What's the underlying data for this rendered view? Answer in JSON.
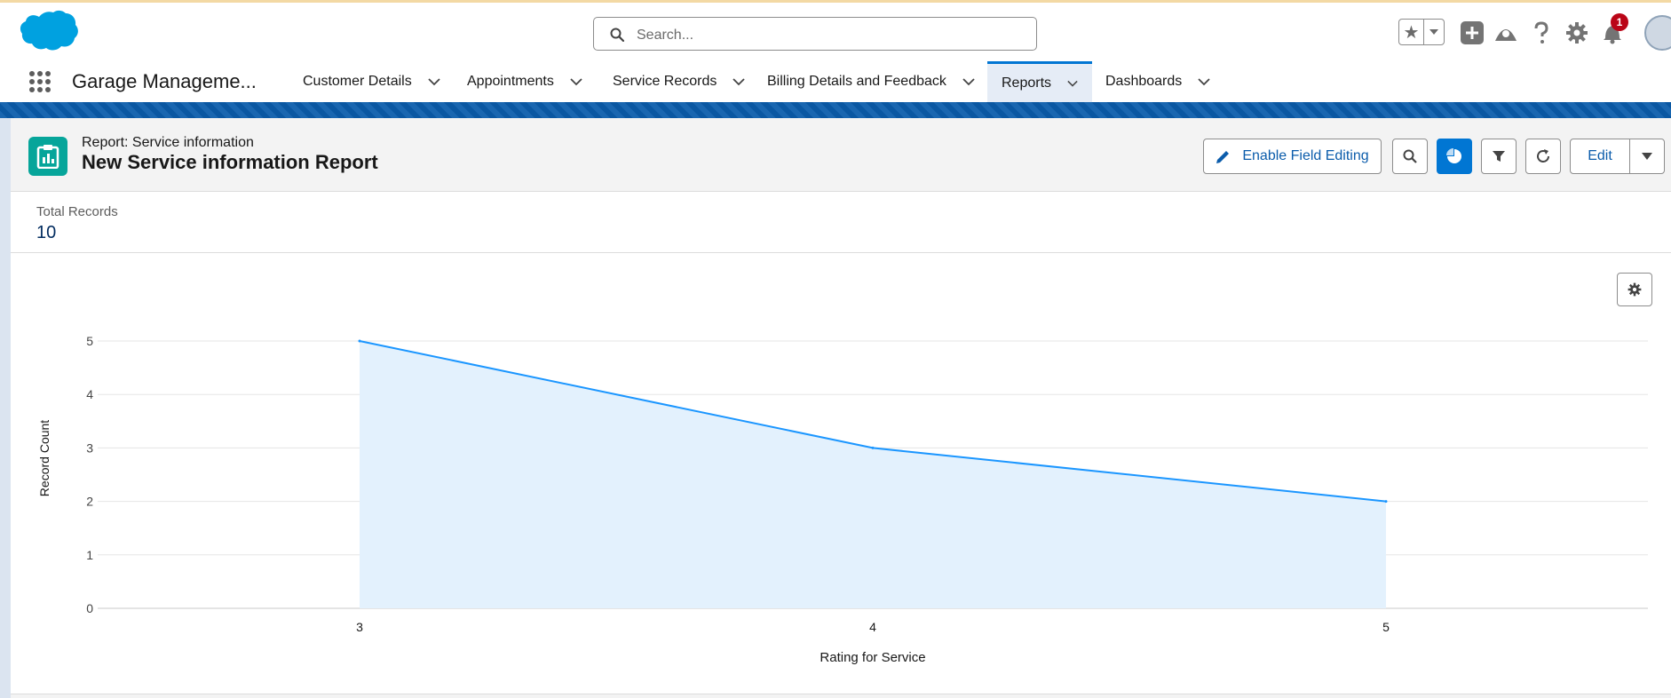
{
  "search": {
    "placeholder": "Search..."
  },
  "notifications": {
    "count": "1"
  },
  "app": {
    "name": "Garage Manageme..."
  },
  "nav": {
    "tabs": [
      {
        "label": "Customer Details"
      },
      {
        "label": "Appointments"
      },
      {
        "label": "Service Records"
      },
      {
        "label": "Billing Details and Feedback"
      },
      {
        "label": "Reports",
        "active": true
      },
      {
        "label": "Dashboards"
      }
    ]
  },
  "report": {
    "type_label": "Report: Service information",
    "title": "New Service information Report",
    "enable_field_editing": "Enable Field Editing",
    "edit": "Edit",
    "total_label": "Total Records",
    "total_value": "10"
  },
  "colors": {
    "brand": "#0176d3",
    "line": "#1b96ff",
    "area": "#e3f1fd",
    "badge": "#ba0517",
    "report_icon": "#06a59a"
  },
  "chart_data": {
    "type": "area",
    "categories": [
      "3",
      "4",
      "5"
    ],
    "values": [
      5,
      3,
      2
    ],
    "xlabel": "Rating for Service",
    "ylabel": "Record Count",
    "ylim": [
      0,
      5
    ],
    "yticks": [
      "0",
      "1",
      "2",
      "3",
      "4",
      "5"
    ],
    "grid": true
  }
}
